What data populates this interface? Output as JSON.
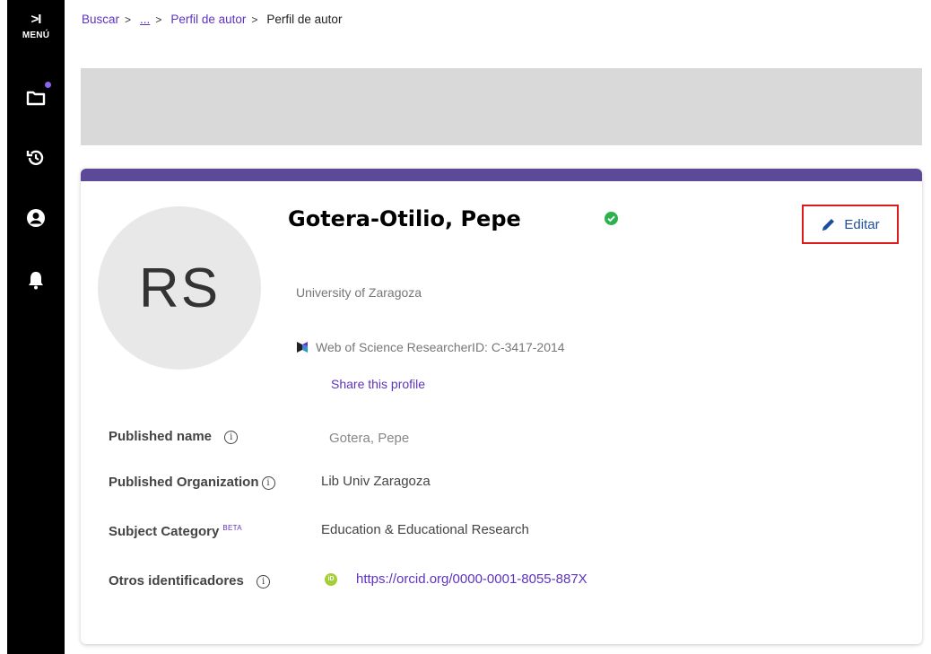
{
  "sidebar": {
    "menu_chevron": ">I",
    "menu_label": "MENÚ",
    "icons": [
      "folder-icon",
      "history-icon",
      "user-icon",
      "bell-icon"
    ],
    "notification_color": "#8a63f0"
  },
  "breadcrumb": {
    "items": [
      "Buscar",
      "...",
      "Perfil de autor",
      "Perfil de autor"
    ],
    "separator": ">"
  },
  "profile": {
    "initials": "RS",
    "name": "Gotera-Otilio, Pepe",
    "verified_icon": "check-circle-icon",
    "edit_label": "Editar",
    "organization": "University of Zaragoza",
    "researcher_id": "Web of Science ResearcherID: C-3417-2014",
    "share_label": "Share this profile",
    "accent_color": "#5c4a99"
  },
  "fields": [
    {
      "label": "Published name",
      "info": "i",
      "value": "Gotera, Pepe"
    },
    {
      "label": "Published Organization",
      "info": "i",
      "value": "Lib Univ Zaragoza"
    },
    {
      "label": "Subject Category",
      "badge": "BETA",
      "value": "Education & Educational Research"
    },
    {
      "label": "Otros identificadores",
      "info": "i",
      "value": "https://orcid.org/0000-0001-8055-887X"
    }
  ]
}
